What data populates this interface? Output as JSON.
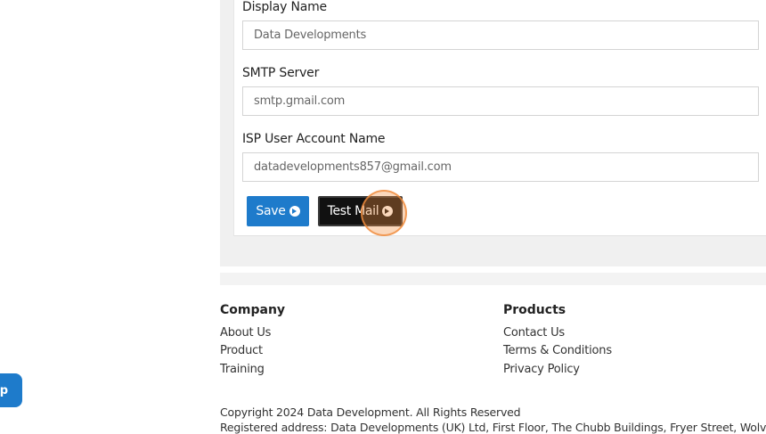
{
  "form": {
    "display_name": {
      "label": "Display Name",
      "value": "Data Developments"
    },
    "smtp_server": {
      "label": "SMTP Server",
      "value": "smtp.gmail.com"
    },
    "isp_user": {
      "label": "ISP User Account Name",
      "value": "datadevelopments857@gmail.com"
    },
    "save_label": "Save",
    "test_mail_label": "Test Mail"
  },
  "footer": {
    "company": {
      "heading": "Company",
      "links": [
        "About Us",
        "Product",
        "Training"
      ]
    },
    "products": {
      "heading": "Products",
      "links": [
        "Contact Us",
        "Terms & Conditions",
        "Privacy Policy"
      ]
    },
    "copyright": "Copyright 2024 Data Development. All Rights Reserved",
    "address": "Registered address: Data Developments (UK) Ltd, First Floor, The Chubb Buildings, Fryer Street, Wolverhampton"
  },
  "help_button": {
    "label": "p"
  },
  "colors": {
    "accent": "#1e7bcb",
    "test_button": "#111111",
    "highlight": "#f08c3c"
  }
}
